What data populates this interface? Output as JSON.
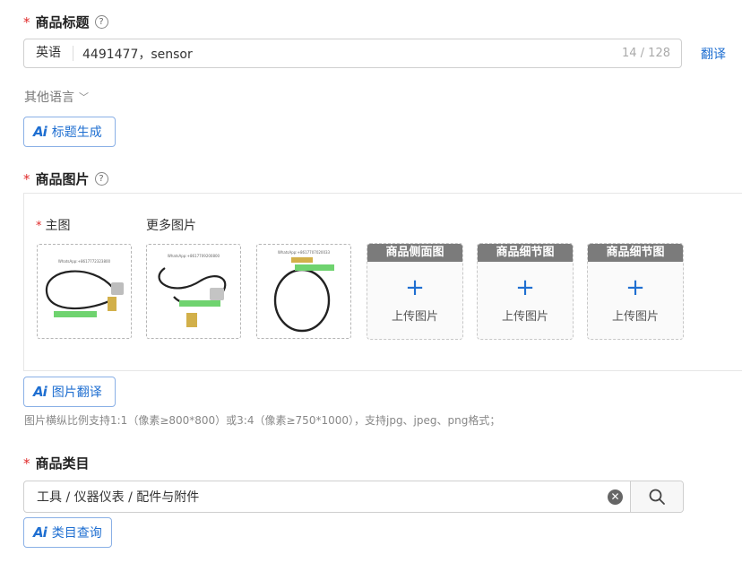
{
  "title_section": {
    "label": "商品标题",
    "help": "?",
    "language_prefix": "英语",
    "value": "4491477，sensor",
    "counter": "14 / 128",
    "translate_label": "翻译",
    "other_languages_label": "其他语言",
    "ai_button_label": "标题生成"
  },
  "image_section": {
    "label": "商品图片",
    "help": "?",
    "main_image_label": "主图",
    "more_images_label": "更多图片",
    "photo_captions": [
      "WhatsApp:+8617772323800",
      "WhatsApp:+8617709200800",
      "WhatsApp:+8617707020033"
    ],
    "slots": [
      {
        "header": "商品侧面图",
        "plus": "+",
        "text": "上传图片"
      },
      {
        "header": "商品细节图",
        "plus": "+",
        "text": "上传图片"
      },
      {
        "header": "商品细节图",
        "plus": "+",
        "text": "上传图片"
      }
    ],
    "ai_button_label": "图片翻译",
    "hint": "图片横纵比例支持1:1（像素≥800*800）或3:4（像素≥750*1000），支持jpg、jpeg、png格式；"
  },
  "category_section": {
    "label": "商品类目",
    "value": "工具 / 仪器仪表 / 配件与附件",
    "clear": "✕",
    "ai_button_label": "类目查询"
  },
  "ai_mark": "Ai",
  "required_mark": "*",
  "chevron": "﹀"
}
